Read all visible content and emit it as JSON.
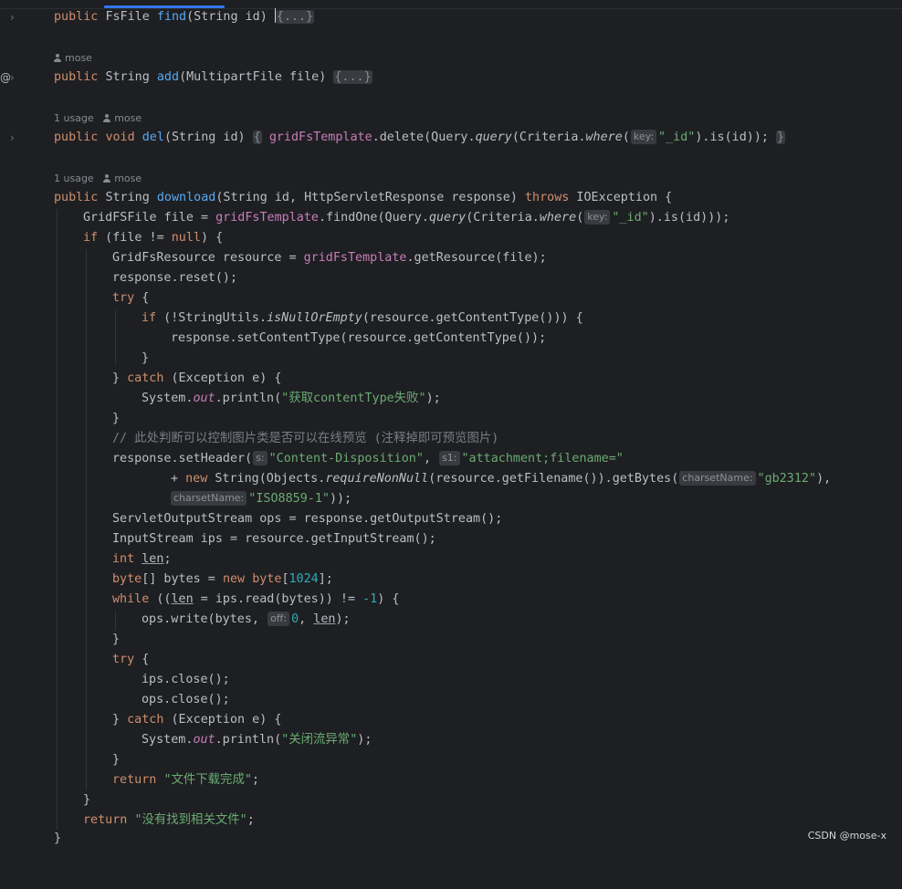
{
  "t": {
    "public": "public",
    "void": "void",
    "if": "if",
    "null": "null",
    "try": "try",
    "catch": "catch",
    "new": "new",
    "int": "int",
    "byte": "byte",
    "while": "while",
    "return": "return",
    "throws": "throws"
  },
  "fold_placeholder": "{...}",
  "author": "mose",
  "usage": "1 usage",
  "hints": {
    "key": "key:",
    "s": "s:",
    "s1": "s1:",
    "charsetName": "charsetName:",
    "off": "off:"
  },
  "strings": {
    "id": "\"_id\"",
    "fail_ct": "\"获取contentType失败\"",
    "cd": "\"Content-Disposition\"",
    "attach": "\"attachment;filename=\"",
    "gb": "\"gb2312\"",
    "iso": "\"ISO8859-1\"",
    "close_err": "\"关闭流异常\"",
    "done": "\"文件下载完成\"",
    "notfound": "\"没有找到相关文件\""
  },
  "nums": {
    "n1024": "1024",
    "neg1": "-1",
    "zero": "0"
  },
  "comment": "// 此处判断可以控制图片类是否可以在线预览 (注释掉即可预览图片)",
  "lines": {
    "l1a": "FsFile ",
    "l1fn": "find",
    "l1b": "(String id) ",
    "l2a": "String ",
    "l2fn": "add",
    "l2b": "(MultipartFile file) ",
    "l3fn": "del",
    "l3b": "(String id) ",
    "l3c": ".delete(Query.",
    "l3d": "(Criteria.",
    "l3e": ").is(id)); ",
    "l4a": "String ",
    "l4fn": "download",
    "l4b": "(String id, HttpServletResponse response) ",
    "l4c": " IOException {",
    "l5a": "GridFSFile file = ",
    "l5b": ".findOne(Query.",
    "l5c": "(Criteria.",
    "l5d": ").is(id)));",
    "l6a": " (file != ",
    "l6b": ") {",
    "l7a": "GridFsResource resource = ",
    "l7b": ".getResource(file);",
    "l8": "response.reset();",
    "l9": " {",
    "l10a": " (!StringUtils.",
    "l10b": "(resource.getContentType())) {",
    "l11": "response.setContentType(resource.getContentType());",
    "close": "}",
    "l13a": "} ",
    "l13b": " (Exception e) {",
    "l14a": "System.",
    "l14b": ".println(",
    "l14c": ");",
    "l17a": "response.setHeader(",
    "l17b": ", ",
    "l18a": "+ ",
    "l18b": " String(Objects.",
    "l18c": "(resource.getFilename()).getBytes(",
    "l18d": "),",
    "l19": "));",
    "l20": "ServletOutputStream ops = response.getOutputStream();",
    "l21": "InputStream ips = resource.getInputStream();",
    "l22b": ";",
    "l23a": "[] bytes = ",
    "l23b": "[",
    "l23c": "];",
    "l24a": " ((",
    "l24b": " = ips.read(bytes)) != ",
    "l24c": ") {",
    "l25a": "ops.write(bytes, ",
    "l25b": ", ",
    "l25c": ");",
    "l28": "ips.close();",
    "l29": "ops.close();",
    "semi": ";",
    "l35": "}"
  },
  "names": {
    "gridFsTemplate": "gridFsTemplate",
    "query": "query",
    "where": "where",
    "isNullOrEmpty": "isNullOrEmpty",
    "out": "out",
    "requireNonNull": "requireNonNull",
    "len": "len"
  },
  "watermark": "CSDN @mose-x",
  "gutter": {
    "at": "@"
  }
}
